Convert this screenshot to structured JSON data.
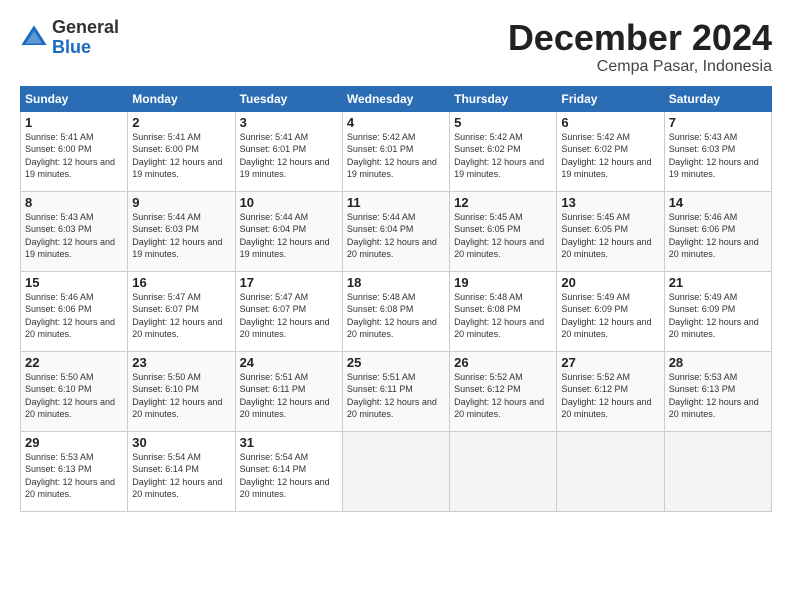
{
  "logo": {
    "general": "General",
    "blue": "Blue"
  },
  "title": "December 2024",
  "location": "Cempa Pasar, Indonesia",
  "days_of_week": [
    "Sunday",
    "Monday",
    "Tuesday",
    "Wednesday",
    "Thursday",
    "Friday",
    "Saturday"
  ],
  "weeks": [
    [
      {
        "day": "1",
        "sunrise": "5:41 AM",
        "sunset": "6:00 PM",
        "daylight": "12 hours and 19 minutes."
      },
      {
        "day": "2",
        "sunrise": "5:41 AM",
        "sunset": "6:00 PM",
        "daylight": "12 hours and 19 minutes."
      },
      {
        "day": "3",
        "sunrise": "5:41 AM",
        "sunset": "6:01 PM",
        "daylight": "12 hours and 19 minutes."
      },
      {
        "day": "4",
        "sunrise": "5:42 AM",
        "sunset": "6:01 PM",
        "daylight": "12 hours and 19 minutes."
      },
      {
        "day": "5",
        "sunrise": "5:42 AM",
        "sunset": "6:02 PM",
        "daylight": "12 hours and 19 minutes."
      },
      {
        "day": "6",
        "sunrise": "5:42 AM",
        "sunset": "6:02 PM",
        "daylight": "12 hours and 19 minutes."
      },
      {
        "day": "7",
        "sunrise": "5:43 AM",
        "sunset": "6:03 PM",
        "daylight": "12 hours and 19 minutes."
      }
    ],
    [
      {
        "day": "8",
        "sunrise": "5:43 AM",
        "sunset": "6:03 PM",
        "daylight": "12 hours and 19 minutes."
      },
      {
        "day": "9",
        "sunrise": "5:44 AM",
        "sunset": "6:03 PM",
        "daylight": "12 hours and 19 minutes."
      },
      {
        "day": "10",
        "sunrise": "5:44 AM",
        "sunset": "6:04 PM",
        "daylight": "12 hours and 19 minutes."
      },
      {
        "day": "11",
        "sunrise": "5:44 AM",
        "sunset": "6:04 PM",
        "daylight": "12 hours and 20 minutes."
      },
      {
        "day": "12",
        "sunrise": "5:45 AM",
        "sunset": "6:05 PM",
        "daylight": "12 hours and 20 minutes."
      },
      {
        "day": "13",
        "sunrise": "5:45 AM",
        "sunset": "6:05 PM",
        "daylight": "12 hours and 20 minutes."
      },
      {
        "day": "14",
        "sunrise": "5:46 AM",
        "sunset": "6:06 PM",
        "daylight": "12 hours and 20 minutes."
      }
    ],
    [
      {
        "day": "15",
        "sunrise": "5:46 AM",
        "sunset": "6:06 PM",
        "daylight": "12 hours and 20 minutes."
      },
      {
        "day": "16",
        "sunrise": "5:47 AM",
        "sunset": "6:07 PM",
        "daylight": "12 hours and 20 minutes."
      },
      {
        "day": "17",
        "sunrise": "5:47 AM",
        "sunset": "6:07 PM",
        "daylight": "12 hours and 20 minutes."
      },
      {
        "day": "18",
        "sunrise": "5:48 AM",
        "sunset": "6:08 PM",
        "daylight": "12 hours and 20 minutes."
      },
      {
        "day": "19",
        "sunrise": "5:48 AM",
        "sunset": "6:08 PM",
        "daylight": "12 hours and 20 minutes."
      },
      {
        "day": "20",
        "sunrise": "5:49 AM",
        "sunset": "6:09 PM",
        "daylight": "12 hours and 20 minutes."
      },
      {
        "day": "21",
        "sunrise": "5:49 AM",
        "sunset": "6:09 PM",
        "daylight": "12 hours and 20 minutes."
      }
    ],
    [
      {
        "day": "22",
        "sunrise": "5:50 AM",
        "sunset": "6:10 PM",
        "daylight": "12 hours and 20 minutes."
      },
      {
        "day": "23",
        "sunrise": "5:50 AM",
        "sunset": "6:10 PM",
        "daylight": "12 hours and 20 minutes."
      },
      {
        "day": "24",
        "sunrise": "5:51 AM",
        "sunset": "6:11 PM",
        "daylight": "12 hours and 20 minutes."
      },
      {
        "day": "25",
        "sunrise": "5:51 AM",
        "sunset": "6:11 PM",
        "daylight": "12 hours and 20 minutes."
      },
      {
        "day": "26",
        "sunrise": "5:52 AM",
        "sunset": "6:12 PM",
        "daylight": "12 hours and 20 minutes."
      },
      {
        "day": "27",
        "sunrise": "5:52 AM",
        "sunset": "6:12 PM",
        "daylight": "12 hours and 20 minutes."
      },
      {
        "day": "28",
        "sunrise": "5:53 AM",
        "sunset": "6:13 PM",
        "daylight": "12 hours and 20 minutes."
      }
    ],
    [
      {
        "day": "29",
        "sunrise": "5:53 AM",
        "sunset": "6:13 PM",
        "daylight": "12 hours and 20 minutes."
      },
      {
        "day": "30",
        "sunrise": "5:54 AM",
        "sunset": "6:14 PM",
        "daylight": "12 hours and 20 minutes."
      },
      {
        "day": "31",
        "sunrise": "5:54 AM",
        "sunset": "6:14 PM",
        "daylight": "12 hours and 20 minutes."
      },
      null,
      null,
      null,
      null
    ]
  ]
}
